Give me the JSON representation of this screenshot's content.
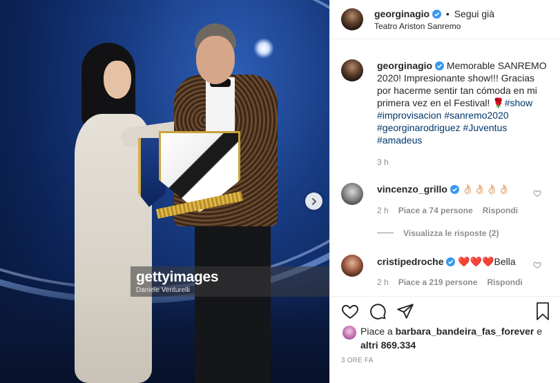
{
  "photo": {
    "watermark_logo": "gettyimages",
    "watermark_credit": "Daniele Venturelli"
  },
  "header": {
    "username": "georginagio",
    "follow_status": "Segui già",
    "location": "Teatro Ariston Sanremo"
  },
  "caption": {
    "username": "georginagio",
    "text": "Memorable SANREMO 2020! Impresionante show!!! Gracias por hacerme sentir tan cómoda en mi primera vez en el Festival! 🌹",
    "hashtags": [
      "#show",
      "#improvisacion",
      "#sanremo2020",
      "#georginarodriguez",
      "#Juventus",
      "#amadeus"
    ],
    "time": "3 h"
  },
  "comments": [
    {
      "username": "vincenzo_grillo",
      "text": "👌🏻👌🏻👌🏻👌🏻",
      "time": "2 h",
      "likes": "Piace a 74 persone",
      "reply": "Rispondi",
      "view_replies": "Visualizza le risposte (2)"
    },
    {
      "username": "cristipedroche",
      "text": "❤️❤️❤️Bella",
      "time": "2 h",
      "likes": "Piace a 219 persone",
      "reply": "Rispondi"
    }
  ],
  "likes": {
    "prefix": "Piace a",
    "user": "barbara_bandeira_fas_forever",
    "conj": "e",
    "others": "altri 869.334"
  },
  "post_date": "3 ORE FA",
  "icons": {
    "like": "heart-icon",
    "comment": "comment-icon",
    "share": "paper-plane-icon",
    "save": "bookmark-icon",
    "next": "chevron-right-icon",
    "verified": "verified-badge-icon"
  },
  "colors": {
    "verified_blue": "#3897f0",
    "link_blue": "#00376b",
    "muted_grey": "#8e8e8e"
  }
}
